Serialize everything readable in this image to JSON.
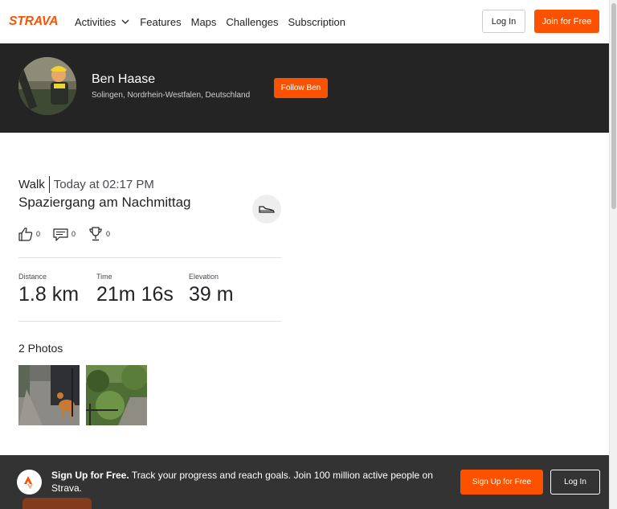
{
  "nav": {
    "logo_text": "STRAVA",
    "links": [
      {
        "label": "Activities",
        "has_dropdown": true
      },
      {
        "label": "Features"
      },
      {
        "label": "Maps"
      },
      {
        "label": "Challenges"
      },
      {
        "label": "Subscription"
      }
    ],
    "login_label": "Log In",
    "join_label": "Join for Free"
  },
  "profile": {
    "name": "Ben Haase",
    "location": "Solingen, Nordrhein-Westfalen, Deutschland",
    "follow_label": "Follow Ben"
  },
  "activity": {
    "type": "Walk",
    "time": "Today at 02:17 PM",
    "title": "Spaziergang am Nachmittag",
    "sport_icon": "shoe-icon",
    "kudos_count": "0",
    "comments_count": "0",
    "achievements_count": "0",
    "stats": [
      {
        "label": "Distance",
        "value": "1.8 km"
      },
      {
        "label": "Time",
        "value": "21m 16s"
      },
      {
        "label": "Elevation",
        "value": "39 m"
      }
    ],
    "photos_title": "2 Photos"
  },
  "banner": {
    "headline": "Sign Up for Free.",
    "text": "Track your progress and reach goals. Join 100 million active people on Strava.",
    "signup_label": "Sign Up for Free",
    "login_label": "Log In"
  },
  "colors": {
    "brand": "#fc5200",
    "header_bg": "#242424",
    "banner_bg": "#333333"
  }
}
